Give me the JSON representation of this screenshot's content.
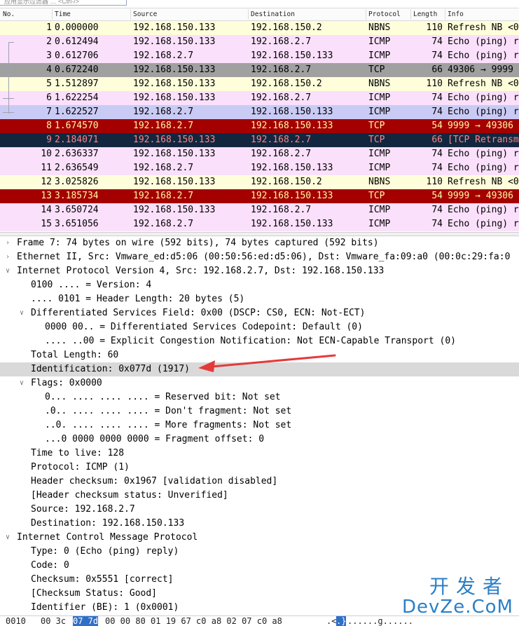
{
  "filter": {
    "placeholder": "应用显示过滤器 … <Ctrl-/>"
  },
  "columns": {
    "no": "No.",
    "time": "Time",
    "source": "Source",
    "destination": "Destination",
    "protocol": "Protocol",
    "length": "Length",
    "info": "Info"
  },
  "packets": [
    {
      "no": "1",
      "time": "0.000000",
      "src": "192.168.150.133",
      "dst": "192.168.150.2",
      "proto": "NBNS",
      "len": "110",
      "info": "Refresh NB <0"
    },
    {
      "no": "2",
      "time": "0.612494",
      "src": "192.168.150.133",
      "dst": "192.168.2.7",
      "proto": "ICMP",
      "len": "74",
      "info": "Echo (ping) r"
    },
    {
      "no": "3",
      "time": "0.612706",
      "src": "192.168.2.7",
      "dst": "192.168.150.133",
      "proto": "ICMP",
      "len": "74",
      "info": "Echo (ping) r"
    },
    {
      "no": "4",
      "time": "0.672240",
      "src": "192.168.150.133",
      "dst": "192.168.2.7",
      "proto": "TCP",
      "len": "66",
      "info": "49306 → 9999"
    },
    {
      "no": "5",
      "time": "1.512897",
      "src": "192.168.150.133",
      "dst": "192.168.150.2",
      "proto": "NBNS",
      "len": "110",
      "info": "Refresh NB <0"
    },
    {
      "no": "6",
      "time": "1.622254",
      "src": "192.168.150.133",
      "dst": "192.168.2.7",
      "proto": "ICMP",
      "len": "74",
      "info": "Echo (ping) r"
    },
    {
      "no": "7",
      "time": "1.622527",
      "src": "192.168.2.7",
      "dst": "192.168.150.133",
      "proto": "ICMP",
      "len": "74",
      "info": "Echo (ping) r"
    },
    {
      "no": "8",
      "time": "1.674570",
      "src": "192.168.2.7",
      "dst": "192.168.150.133",
      "proto": "TCP",
      "len": "54",
      "info": "9999 → 49306"
    },
    {
      "no": "9",
      "time": "2.184071",
      "src": "192.168.150.133",
      "dst": "192.168.2.7",
      "proto": "TCP",
      "len": "66",
      "info": "[TCP Retransm"
    },
    {
      "no": "10",
      "time": "2.636337",
      "src": "192.168.150.133",
      "dst": "192.168.2.7",
      "proto": "ICMP",
      "len": "74",
      "info": "Echo (ping) r"
    },
    {
      "no": "11",
      "time": "2.636549",
      "src": "192.168.2.7",
      "dst": "192.168.150.133",
      "proto": "ICMP",
      "len": "74",
      "info": "Echo (ping) r"
    },
    {
      "no": "12",
      "time": "3.025826",
      "src": "192.168.150.133",
      "dst": "192.168.150.2",
      "proto": "NBNS",
      "len": "110",
      "info": "Refresh NB <0"
    },
    {
      "no": "13",
      "time": "3.185734",
      "src": "192.168.2.7",
      "dst": "192.168.150.133",
      "proto": "TCP",
      "len": "54",
      "info": "9999 → 49306"
    },
    {
      "no": "14",
      "time": "3.650724",
      "src": "192.168.150.133",
      "dst": "192.168.2.7",
      "proto": "ICMP",
      "len": "74",
      "info": "Echo (ping) r"
    },
    {
      "no": "15",
      "time": "3.651056",
      "src": "192.168.2.7",
      "dst": "192.168.150.133",
      "proto": "ICMP",
      "len": "74",
      "info": "Echo (ping) r"
    }
  ],
  "row_styles": [
    "nbns",
    "icmp",
    "icmp",
    "tcp-gray",
    "nbns",
    "icmp",
    "sel",
    "tcp-red",
    "tcp-dark",
    "icmp",
    "icmp",
    "nbns",
    "tcp-red",
    "icmp",
    "icmp"
  ],
  "details": [
    {
      "indent": 0,
      "toggle": "collapsed",
      "text": "Frame 7: 74 bytes on wire (592 bits), 74 bytes captured (592 bits)"
    },
    {
      "indent": 0,
      "toggle": "collapsed",
      "text": "Ethernet II, Src: Vmware_ed:d5:06 (00:50:56:ed:d5:06), Dst: Vmware_fa:09:a0 (00:0c:29:fa:0"
    },
    {
      "indent": 0,
      "toggle": "expanded",
      "text": "Internet Protocol Version 4, Src: 192.168.2.7, Dst: 192.168.150.133"
    },
    {
      "indent": 1,
      "toggle": "none",
      "text": "0100 .... = Version: 4"
    },
    {
      "indent": 1,
      "toggle": "none",
      "text": ".... 0101 = Header Length: 20 bytes (5)"
    },
    {
      "indent": 1,
      "toggle": "expanded",
      "text": "Differentiated Services Field: 0x00 (DSCP: CS0, ECN: Not-ECT)"
    },
    {
      "indent": 2,
      "toggle": "none",
      "text": "0000 00.. = Differentiated Services Codepoint: Default (0)"
    },
    {
      "indent": 2,
      "toggle": "none",
      "text": ".... ..00 = Explicit Congestion Notification: Not ECN-Capable Transport (0)"
    },
    {
      "indent": 1,
      "toggle": "none",
      "text": "Total Length: 60"
    },
    {
      "indent": 1,
      "toggle": "none",
      "text": "Identification: 0x077d (1917)",
      "highlight": true
    },
    {
      "indent": 1,
      "toggle": "expanded",
      "text": "Flags: 0x0000"
    },
    {
      "indent": 2,
      "toggle": "none",
      "text": "0... .... .... .... = Reserved bit: Not set"
    },
    {
      "indent": 2,
      "toggle": "none",
      "text": ".0.. .... .... .... = Don't fragment: Not set"
    },
    {
      "indent": 2,
      "toggle": "none",
      "text": "..0. .... .... .... = More fragments: Not set"
    },
    {
      "indent": 2,
      "toggle": "none",
      "text": "...0 0000 0000 0000 = Fragment offset: 0"
    },
    {
      "indent": 1,
      "toggle": "none",
      "text": "Time to live: 128"
    },
    {
      "indent": 1,
      "toggle": "none",
      "text": "Protocol: ICMP (1)"
    },
    {
      "indent": 1,
      "toggle": "none",
      "text": "Header checksum: 0x1967 [validation disabled]"
    },
    {
      "indent": 1,
      "toggle": "none",
      "text": "[Header checksum status: Unverified]"
    },
    {
      "indent": 1,
      "toggle": "none",
      "text": "Source: 192.168.2.7"
    },
    {
      "indent": 1,
      "toggle": "none",
      "text": "Destination: 192.168.150.133"
    },
    {
      "indent": 0,
      "toggle": "expanded",
      "text": "Internet Control Message Protocol"
    },
    {
      "indent": 1,
      "toggle": "none",
      "text": "Type: 0 (Echo (ping) reply)"
    },
    {
      "indent": 1,
      "toggle": "none",
      "text": "Code: 0"
    },
    {
      "indent": 1,
      "toggle": "none",
      "text": "Checksum: 0x5551 [correct]"
    },
    {
      "indent": 1,
      "toggle": "none",
      "text": "[Checksum Status: Good]"
    },
    {
      "indent": 1,
      "toggle": "none",
      "text": "Identifier (BE): 1 (0x0001)"
    }
  ],
  "bytes_pane": {
    "offset": "0010",
    "hex_before": "00 3c",
    "hex_selected": "07 7d",
    "hex_after": "00 00 80 01  19 67 c0 a8 02 07 c0 a8",
    "ascii_before": ".<",
    "ascii_selected": ".}",
    "ascii_after": "......g......"
  },
  "watermark": {
    "line1": "开发者",
    "line2": "DevZe.CoM"
  },
  "colors": {
    "annotation_arrow": "#e53a3a",
    "selected_row": "#c9cbf4",
    "tcp_red": "#a40000",
    "tcp_dark": "#12273f"
  }
}
